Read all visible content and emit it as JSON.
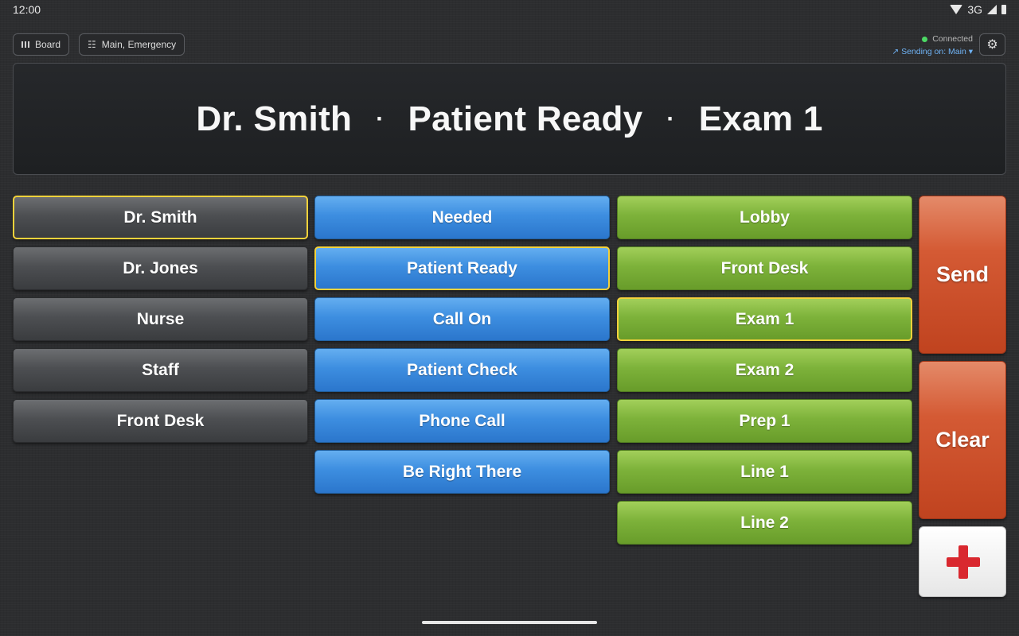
{
  "status_bar": {
    "time": "12:00",
    "network": "3G"
  },
  "toolbar": {
    "board_label": "Board",
    "filter_label": "Main, Emergency",
    "connection_status": "Connected",
    "sending_on": "Sending on: Main",
    "connected_color": "#4cd964"
  },
  "display": {
    "person": "Dr. Smith",
    "separator": "·",
    "message": "Patient Ready",
    "location": "Exam 1"
  },
  "people": [
    "Dr. Smith",
    "Dr. Jones",
    "Nurse",
    "Staff",
    "Front Desk"
  ],
  "messages": [
    "Needed",
    "Patient Ready",
    "Call On",
    "Patient Check",
    "Phone Call",
    "Be Right There"
  ],
  "locations": [
    "Lobby",
    "Front Desk",
    "Exam 1",
    "Exam 2",
    "Prep 1",
    "Line 1",
    "Line 2"
  ],
  "selected": {
    "person": "Dr. Smith",
    "message": "Patient Ready",
    "location": "Exam 1"
  },
  "actions": {
    "send_label": "Send",
    "clear_label": "Clear",
    "emergency_icon": "red-cross-icon"
  },
  "colors": {
    "person": "#4d4f52",
    "message": "#3d8ee0",
    "location": "#7db23a",
    "action": "#d45a34",
    "selection": "#f5d23b"
  }
}
